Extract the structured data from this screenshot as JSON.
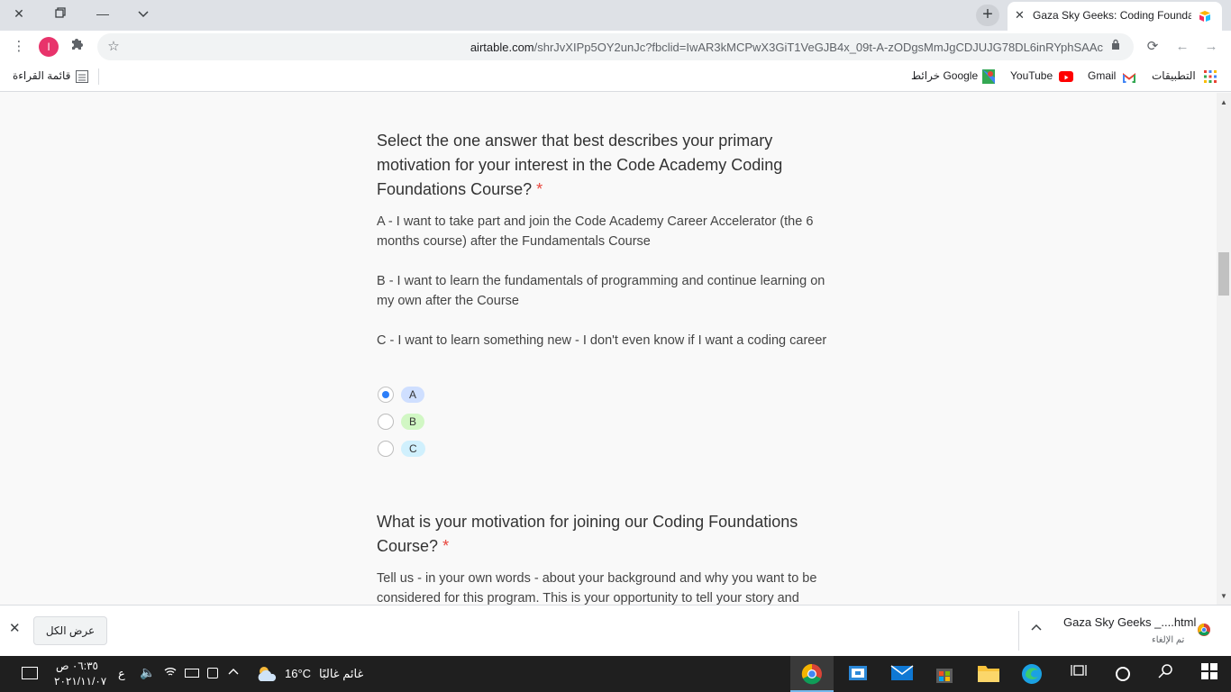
{
  "browser": {
    "tab_title": "Gaza Sky Geeks: Coding Foundat",
    "url_host": "airtable.com",
    "url_path": "/shrJvXIPp5OY2unJc?fbclid=IwAR3kMCPwX3GiT1VeGJB4x_09t-A-zODgsMmJgCDJUJG78DL6inRYphSAAc",
    "avatar_letter": "I",
    "bookmarks": {
      "apps": "التطبيقات",
      "gmail": "Gmail",
      "youtube": "YouTube",
      "maps": "خرائط Google",
      "reading_list": "قائمة القراءة"
    }
  },
  "form": {
    "q1": {
      "title": "Select the one answer that best describes your primary motivation for your interest in the Code Academy Coding Foundations Course?",
      "required_mark": "*",
      "desc_a": "A - I want to take part and join the Code Academy Career Accelerator (the 6 months course) after the Fundamentals Course",
      "desc_b": "B - I want to learn the fundamentals of programming and continue learning on my own after the Course",
      "desc_c": "C - I want to learn something new - I don't even know if I want a coding career",
      "options": [
        {
          "label": "A",
          "selected": true,
          "color": "#cfdfff"
        },
        {
          "label": "B",
          "selected": false,
          "color": "#d1f7c4"
        },
        {
          "label": "C",
          "selected": false,
          "color": "#d0f0fd"
        }
      ]
    },
    "q2": {
      "title": "What is your motivation for joining our Coding Foundations Course?",
      "required_mark": "*",
      "desc": "Tell us - in your own words - about your background and why you want to be considered for this program. This is your opportunity to tell your story and"
    }
  },
  "downloads": {
    "file_name": "Gaza Sky Geeks _....html",
    "status": "تم الإلغاء",
    "show_all": "عرض الكل"
  },
  "taskbar": {
    "time": "٠٦:٣٥ ص",
    "date": "٢٠٢١/١١/٠٧",
    "lang": "ع",
    "temperature": "16°C",
    "weather": "غائم غالبًا"
  }
}
